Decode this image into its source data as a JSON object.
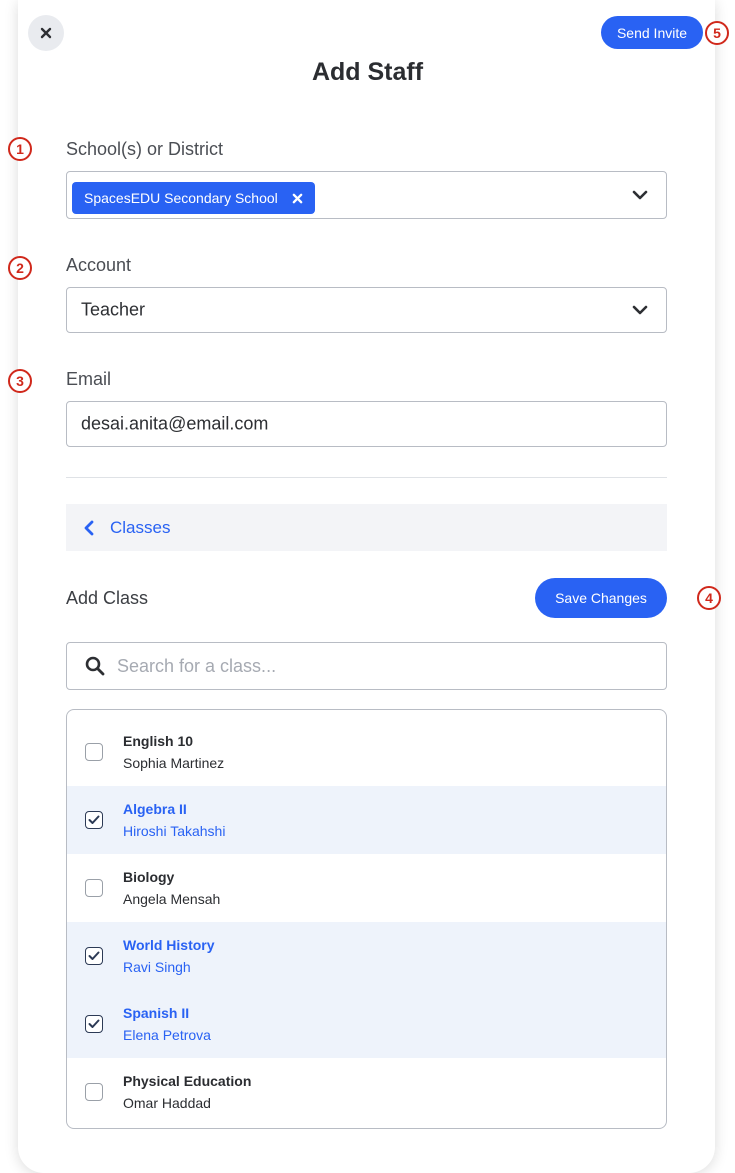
{
  "header": {
    "title": "Add Staff",
    "send_invite_label": "Send Invite"
  },
  "markers": [
    "1",
    "2",
    "3",
    "4",
    "5"
  ],
  "school_field": {
    "label": "School(s) or District",
    "selected_chip": "SpacesEDU Secondary School"
  },
  "account_field": {
    "label": "Account",
    "value": "Teacher"
  },
  "email_field": {
    "label": "Email",
    "value": "desai.anita@email.com"
  },
  "classes_nav": {
    "label": "Classes"
  },
  "add_class": {
    "label": "Add Class",
    "save_label": "Save Changes",
    "search_placeholder": "Search for a class..."
  },
  "class_list": [
    {
      "name": "English 10",
      "teacher": "Sophia Martinez",
      "checked": false
    },
    {
      "name": "Algebra II",
      "teacher": "Hiroshi Takahshi",
      "checked": true
    },
    {
      "name": "Biology",
      "teacher": "Angela Mensah",
      "checked": false
    },
    {
      "name": "World History",
      "teacher": "Ravi Singh",
      "checked": true
    },
    {
      "name": "Spanish II",
      "teacher": "Elena Petrova",
      "checked": true
    },
    {
      "name": "Physical Education",
      "teacher": "Omar Haddad",
      "checked": false
    }
  ],
  "colors": {
    "accent": "#2962f3",
    "marker": "#d0281b",
    "checked_row_bg": "#eef3fb"
  },
  "icons": {
    "close": "close-icon",
    "chevron": "chevron-down-icon",
    "back": "chevron-left-icon",
    "search": "search-icon",
    "check": "check-icon"
  }
}
